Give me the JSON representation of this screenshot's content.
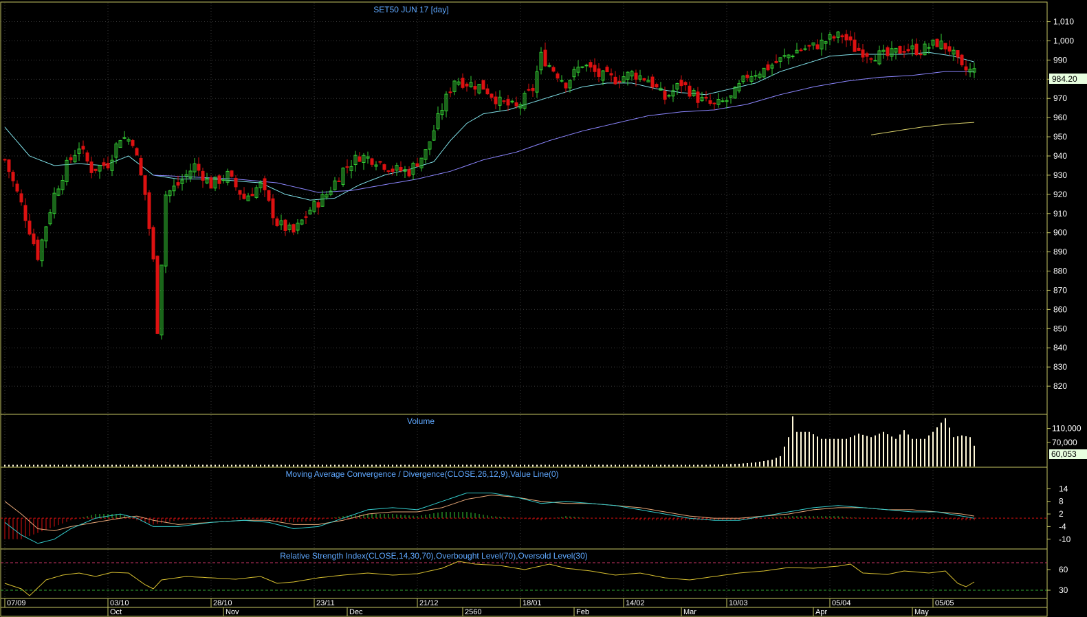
{
  "colors": {
    "background": "#000000",
    "frame": "#c8c864",
    "grid": "#3a3a3a",
    "title": "#5fa8ff",
    "axis_text": "#ffffff",
    "up_candle": "#33cc33",
    "down_candle": "#dd1111",
    "ma_fast": "#7fe0e8",
    "ma_mid": "#8c86ff",
    "ma_slow": "#d8cf6a",
    "volume": "#fff8d8",
    "macd_line": "#33cccc",
    "signal_line": "#e8a878",
    "rsi_line": "#d8c030",
    "overbought": "#cc3366",
    "oversold": "#33aa33",
    "price_tag_bg": "#e8ffe0"
  },
  "chart_data": [
    {
      "type": "candlestick",
      "title": "SET50 JUN 17   [day]",
      "ylim": [
        810,
        1017
      ],
      "y_ticks": [
        820,
        830,
        840,
        850,
        860,
        870,
        880,
        890,
        900,
        910,
        920,
        930,
        940,
        950,
        960,
        970,
        980,
        990,
        1000,
        1010
      ],
      "y_tick_labels": [
        "820",
        "830",
        "840",
        "850",
        "860",
        "870",
        "880",
        "890",
        "900",
        "910",
        "920",
        "930",
        "940",
        "950",
        "960",
        "970",
        "980",
        "990",
        "1,000",
        "1,010"
      ],
      "last_price": "984.20",
      "close_anchors": [
        [
          0,
          938
        ],
        [
          4,
          915
        ],
        [
          8,
          888
        ],
        [
          12,
          920
        ],
        [
          15,
          935
        ],
        [
          18,
          945
        ],
        [
          21,
          933
        ],
        [
          25,
          936
        ],
        [
          28,
          950
        ],
        [
          31,
          948
        ],
        [
          34,
          920
        ],
        [
          36,
          885
        ],
        [
          37,
          850
        ],
        [
          39,
          920
        ],
        [
          42,
          925
        ],
        [
          46,
          935
        ],
        [
          50,
          925
        ],
        [
          54,
          930
        ],
        [
          58,
          918
        ],
        [
          62,
          925
        ],
        [
          66,
          905
        ],
        [
          70,
          900
        ],
        [
          74,
          912
        ],
        [
          78,
          920
        ],
        [
          82,
          933
        ],
        [
          86,
          940
        ],
        [
          90,
          938
        ],
        [
          94,
          933
        ],
        [
          98,
          932
        ],
        [
          102,
          942
        ],
        [
          106,
          965
        ],
        [
          109,
          980
        ],
        [
          112,
          978
        ],
        [
          116,
          976
        ],
        [
          120,
          968
        ],
        [
          124,
          965
        ],
        [
          128,
          975
        ],
        [
          130,
          992
        ],
        [
          133,
          985
        ],
        [
          136,
          978
        ],
        [
          140,
          988
        ],
        [
          144,
          982
        ],
        [
          148,
          980
        ],
        [
          152,
          983
        ],
        [
          156,
          980
        ],
        [
          160,
          970
        ],
        [
          164,
          978
        ],
        [
          168,
          970
        ],
        [
          172,
          966
        ],
        [
          176,
          970
        ],
        [
          180,
          982
        ],
        [
          184,
          985
        ],
        [
          188,
          990
        ],
        [
          192,
          995
        ],
        [
          196,
          997
        ],
        [
          200,
          1001
        ],
        [
          203,
          1003
        ],
        [
          206,
          996
        ],
        [
          210,
          993
        ],
        [
          214,
          992
        ],
        [
          218,
          996
        ],
        [
          222,
          995
        ],
        [
          226,
          999
        ],
        [
          229,
          996
        ],
        [
          232,
          985
        ],
        [
          235,
          984.2
        ]
      ],
      "ma_fast_anchors": [
        [
          0,
          955
        ],
        [
          6,
          940
        ],
        [
          12,
          935
        ],
        [
          18,
          936
        ],
        [
          24,
          935
        ],
        [
          30,
          940
        ],
        [
          36,
          930
        ],
        [
          42,
          928
        ],
        [
          50,
          928
        ],
        [
          56,
          927
        ],
        [
          62,
          926
        ],
        [
          68,
          920
        ],
        [
          74,
          917
        ],
        [
          80,
          918
        ],
        [
          86,
          925
        ],
        [
          92,
          930
        ],
        [
          98,
          933
        ],
        [
          104,
          937
        ],
        [
          108,
          948
        ],
        [
          112,
          957
        ],
        [
          116,
          962
        ],
        [
          122,
          964
        ],
        [
          128,
          968
        ],
        [
          134,
          972
        ],
        [
          140,
          976
        ],
        [
          146,
          978
        ],
        [
          152,
          978
        ],
        [
          158,
          975
        ],
        [
          164,
          973
        ],
        [
          170,
          972
        ],
        [
          176,
          975
        ],
        [
          182,
          978
        ],
        [
          188,
          984
        ],
        [
          194,
          988
        ],
        [
          200,
          992
        ],
        [
          206,
          993
        ],
        [
          212,
          993
        ],
        [
          218,
          993
        ],
        [
          224,
          994
        ],
        [
          230,
          992
        ],
        [
          235,
          989
        ]
      ],
      "ma_mid_anchors": [
        [
          36,
          930
        ],
        [
          46,
          929
        ],
        [
          56,
          928
        ],
        [
          66,
          926
        ],
        [
          76,
          921
        ],
        [
          84,
          922
        ],
        [
          92,
          925
        ],
        [
          100,
          928
        ],
        [
          108,
          932
        ],
        [
          116,
          938
        ],
        [
          124,
          942
        ],
        [
          132,
          948
        ],
        [
          140,
          953
        ],
        [
          148,
          957
        ],
        [
          156,
          961
        ],
        [
          164,
          963
        ],
        [
          172,
          964
        ],
        [
          180,
          967
        ],
        [
          188,
          972
        ],
        [
          196,
          976
        ],
        [
          204,
          979
        ],
        [
          212,
          981
        ],
        [
          220,
          982
        ],
        [
          228,
          984
        ],
        [
          235,
          984
        ]
      ],
      "ma_slow_anchors": [
        [
          210,
          951
        ],
        [
          216,
          953
        ],
        [
          222,
          955
        ],
        [
          228,
          956.5
        ],
        [
          235,
          957.5
        ]
      ],
      "x_tick_labels": [
        "07/09",
        "03/10",
        "28/10",
        "23/11",
        "21/12",
        "18/01",
        "14/02",
        "10/03",
        "05/04",
        "05/05"
      ],
      "x_tick_index": [
        0,
        25,
        50,
        75,
        100,
        125,
        150,
        175,
        200,
        225
      ],
      "month_labels": [
        "Oct",
        "Nov",
        "Dec",
        "2560",
        "Feb",
        "Mar",
        "Apr",
        "May"
      ],
      "month_index": [
        25,
        53,
        83,
        111,
        138,
        164,
        196,
        220
      ]
    },
    {
      "type": "bar",
      "title": "Volume",
      "ylim": [
        0,
        145000
      ],
      "y_tick_labels": [
        "110,000",
        "70,000"
      ],
      "y_ticks": [
        110000,
        70000
      ],
      "last_value": "60,053",
      "volume_anchors": [
        [
          0,
          5000
        ],
        [
          170,
          5000
        ],
        [
          178,
          8000
        ],
        [
          182,
          12000
        ],
        [
          186,
          20000
        ],
        [
          188,
          30000
        ],
        [
          190,
          85000
        ],
        [
          191,
          145000
        ],
        [
          192,
          100000
        ],
        [
          195,
          100000
        ],
        [
          198,
          80000
        ],
        [
          201,
          80000
        ],
        [
          204,
          80000
        ],
        [
          207,
          95000
        ],
        [
          210,
          85000
        ],
        [
          213,
          100000
        ],
        [
          216,
          80000
        ],
        [
          218,
          105000
        ],
        [
          220,
          80000
        ],
        [
          223,
          80000
        ],
        [
          225,
          100000
        ],
        [
          228,
          140000
        ],
        [
          230,
          85000
        ],
        [
          232,
          90000
        ],
        [
          234,
          85000
        ],
        [
          235,
          60053
        ]
      ]
    },
    {
      "type": "line",
      "title": "Moving Average Convergence / Divergence(CLOSE,26,12,9),Value Line(0)",
      "ylim": [
        -14,
        20
      ],
      "y_ticks": [
        14,
        8,
        2,
        -4,
        -10
      ],
      "y_tick_labels": [
        "14",
        "8",
        "2",
        "-4",
        "-10"
      ],
      "macd_anchors": [
        [
          0,
          -2
        ],
        [
          4,
          -8
        ],
        [
          8,
          -12
        ],
        [
          12,
          -10
        ],
        [
          16,
          -5
        ],
        [
          22,
          0
        ],
        [
          28,
          2
        ],
        [
          32,
          0
        ],
        [
          36,
          -4
        ],
        [
          42,
          -4
        ],
        [
          50,
          -2
        ],
        [
          58,
          -1
        ],
        [
          64,
          -2
        ],
        [
          70,
          -5
        ],
        [
          76,
          -4
        ],
        [
          82,
          0
        ],
        [
          88,
          4
        ],
        [
          94,
          5
        ],
        [
          100,
          4
        ],
        [
          106,
          8
        ],
        [
          112,
          12
        ],
        [
          118,
          12
        ],
        [
          124,
          10
        ],
        [
          130,
          7
        ],
        [
          136,
          8
        ],
        [
          142,
          7
        ],
        [
          148,
          6
        ],
        [
          154,
          4
        ],
        [
          160,
          2
        ],
        [
          166,
          0
        ],
        [
          172,
          -1
        ],
        [
          178,
          -1
        ],
        [
          184,
          1
        ],
        [
          190,
          3
        ],
        [
          196,
          5
        ],
        [
          202,
          6
        ],
        [
          208,
          5
        ],
        [
          214,
          4
        ],
        [
          220,
          3
        ],
        [
          226,
          3
        ],
        [
          232,
          1
        ],
        [
          235,
          0
        ]
      ],
      "signal_anchors": [
        [
          0,
          8
        ],
        [
          4,
          2
        ],
        [
          8,
          -5
        ],
        [
          12,
          -6
        ],
        [
          16,
          -4
        ],
        [
          22,
          -2
        ],
        [
          28,
          0
        ],
        [
          32,
          1
        ],
        [
          36,
          -1
        ],
        [
          42,
          -3
        ],
        [
          50,
          -2
        ],
        [
          58,
          -1
        ],
        [
          64,
          -1
        ],
        [
          70,
          -3
        ],
        [
          76,
          -3
        ],
        [
          82,
          -1
        ],
        [
          88,
          2
        ],
        [
          94,
          3
        ],
        [
          100,
          3
        ],
        [
          106,
          5
        ],
        [
          112,
          9
        ],
        [
          118,
          11
        ],
        [
          124,
          10
        ],
        [
          130,
          8
        ],
        [
          136,
          7
        ],
        [
          142,
          7
        ],
        [
          148,
          6
        ],
        [
          154,
          5
        ],
        [
          160,
          3
        ],
        [
          166,
          1
        ],
        [
          172,
          0
        ],
        [
          178,
          0
        ],
        [
          184,
          1
        ],
        [
          190,
          2
        ],
        [
          196,
          4
        ],
        [
          202,
          5
        ],
        [
          208,
          5
        ],
        [
          214,
          4
        ],
        [
          220,
          4
        ],
        [
          226,
          3
        ],
        [
          232,
          2
        ],
        [
          235,
          1
        ]
      ]
    },
    {
      "type": "line",
      "title": "Relative Strength Index(CLOSE,14,30,70),Overbought Level(70),Oversold Level(30)",
      "ylim": [
        20,
        80
      ],
      "y_ticks": [
        60,
        30
      ],
      "y_tick_labels": [
        "60",
        "30"
      ],
      "overbought": 70,
      "oversold": 30,
      "rsi_anchors": [
        [
          0,
          40
        ],
        [
          4,
          32
        ],
        [
          6,
          22
        ],
        [
          10,
          45
        ],
        [
          14,
          52
        ],
        [
          18,
          55
        ],
        [
          22,
          50
        ],
        [
          26,
          56
        ],
        [
          30,
          55
        ],
        [
          34,
          38
        ],
        [
          36,
          32
        ],
        [
          38,
          45
        ],
        [
          44,
          50
        ],
        [
          50,
          48
        ],
        [
          56,
          46
        ],
        [
          62,
          50
        ],
        [
          66,
          40
        ],
        [
          70,
          42
        ],
        [
          76,
          48
        ],
        [
          82,
          52
        ],
        [
          88,
          55
        ],
        [
          94,
          52
        ],
        [
          100,
          54
        ],
        [
          106,
          62
        ],
        [
          110,
          72
        ],
        [
          114,
          68
        ],
        [
          120,
          66
        ],
        [
          126,
          60
        ],
        [
          132,
          68
        ],
        [
          136,
          62
        ],
        [
          142,
          58
        ],
        [
          148,
          52
        ],
        [
          154,
          55
        ],
        [
          160,
          48
        ],
        [
          166,
          45
        ],
        [
          172,
          50
        ],
        [
          178,
          55
        ],
        [
          184,
          58
        ],
        [
          190,
          63
        ],
        [
          196,
          62
        ],
        [
          202,
          65
        ],
        [
          205,
          68
        ],
        [
          208,
          55
        ],
        [
          214,
          53
        ],
        [
          218,
          58
        ],
        [
          224,
          55
        ],
        [
          228,
          58
        ],
        [
          231,
          40
        ],
        [
          233,
          35
        ],
        [
          235,
          42
        ]
      ]
    }
  ]
}
